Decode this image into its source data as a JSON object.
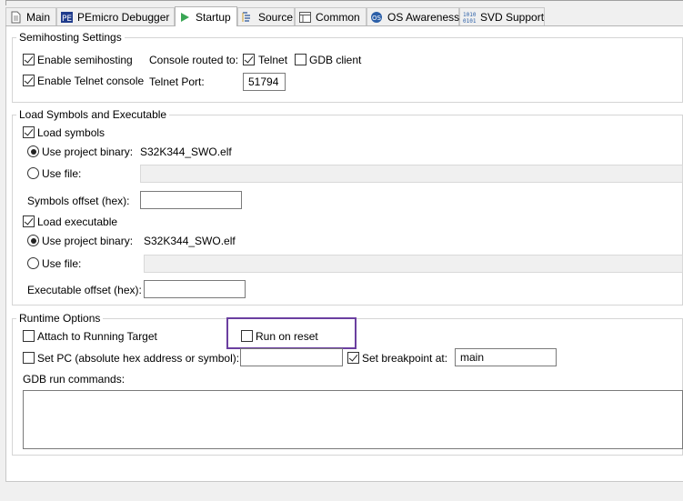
{
  "tabs": [
    {
      "label": "Main",
      "icon": "document-icon"
    },
    {
      "label": "PEmicro Debugger",
      "icon": "pemicro-icon"
    },
    {
      "label": "Startup",
      "icon": "play-icon",
      "active": true
    },
    {
      "label": "Source",
      "icon": "source-icon"
    },
    {
      "label": "Common",
      "icon": "common-icon"
    },
    {
      "label": "OS Awareness",
      "icon": "os-awareness-icon"
    },
    {
      "label": "SVD Support",
      "icon": "svd-icon"
    }
  ],
  "semihosting": {
    "title": "Semihosting Settings",
    "enable_semihosting": {
      "label": "Enable semihosting",
      "checked": true
    },
    "enable_telnet_console": {
      "label": "Enable Telnet console",
      "checked": true
    },
    "console_routed_label": "Console routed to:",
    "telnet": {
      "label": "Telnet",
      "checked": true
    },
    "gdb_client": {
      "label": "GDB client",
      "checked": false
    },
    "telnet_port_label": "Telnet Port:",
    "telnet_port_value": "51794"
  },
  "load": {
    "title": "Load Symbols and Executable",
    "load_symbols": {
      "label": "Load symbols",
      "checked": true
    },
    "symbols_use_project_binary": {
      "label": "Use project binary:",
      "value": "S32K344_SWO.elf"
    },
    "symbols_use_file": {
      "label": "Use file:"
    },
    "symbols_offset_label": "Symbols offset (hex):",
    "load_executable": {
      "label": "Load executable",
      "checked": true
    },
    "exec_use_project_binary": {
      "label": "Use project binary:",
      "value": "S32K344_SWO.elf"
    },
    "exec_use_file": {
      "label": "Use file:"
    },
    "exec_offset_label": "Executable offset (hex):"
  },
  "runtime": {
    "title": "Runtime Options",
    "attach": {
      "label": "Attach to Running Target",
      "checked": false
    },
    "run_on_reset": {
      "label": "Run on reset",
      "checked": false
    },
    "set_pc": {
      "label": "Set PC (absolute hex address or symbol):",
      "checked": false
    },
    "set_breakpoint": {
      "label": "Set breakpoint at:",
      "checked": true
    },
    "breakpoint_value": "main",
    "gdb_run_commands_label": "GDB run commands:"
  },
  "colors": {
    "highlight": "#6b3fa0"
  }
}
